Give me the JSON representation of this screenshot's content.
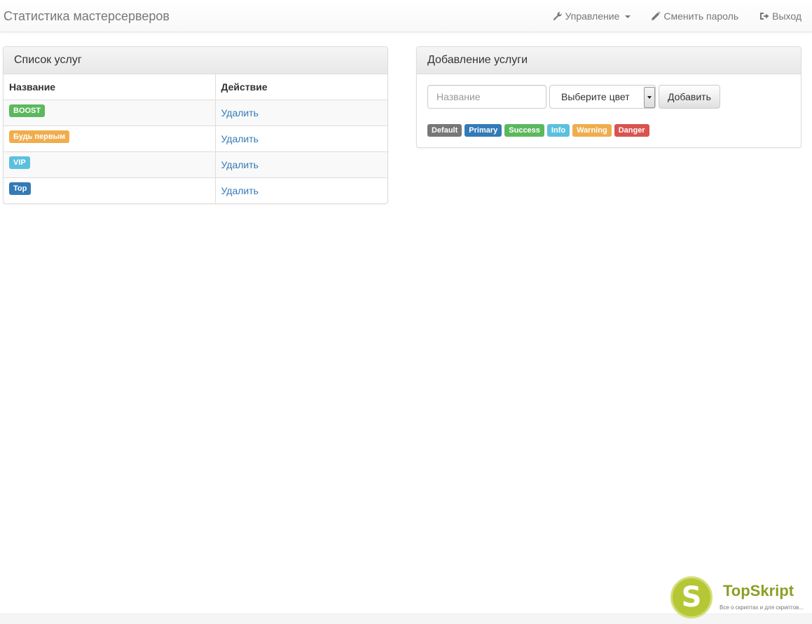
{
  "navbar": {
    "brand": "Статистика мастерсерверов",
    "manage_label": "Управление",
    "change_password_label": "Сменить пароль",
    "logout_label": "Выход"
  },
  "services_panel": {
    "title": "Список услуг",
    "columns": [
      "Название",
      "Действие"
    ],
    "rows": [
      {
        "name": "BOOST",
        "color": "#5cb85c",
        "action": "Удалить"
      },
      {
        "name": "Будь первым",
        "color": "#f0ad4e",
        "action": "Удалить"
      },
      {
        "name": "VIP",
        "color": "#5bc0de",
        "action": "Удалить"
      },
      {
        "name": "Top",
        "color": "#337ab7",
        "action": "Удалить"
      }
    ]
  },
  "add_panel": {
    "title": "Добавление услуги",
    "name_placeholder": "Название",
    "color_select_value": "Выберите цвет",
    "add_button": "Добавить",
    "color_labels": [
      {
        "text": "Default",
        "color": "#777777"
      },
      {
        "text": "Primary",
        "color": "#337ab7"
      },
      {
        "text": "Success",
        "color": "#5cb85c"
      },
      {
        "text": "Info",
        "color": "#5bc0de"
      },
      {
        "text": "Warning",
        "color": "#f0ad4e"
      },
      {
        "text": "Danger",
        "color": "#d9534f"
      }
    ]
  },
  "watermark": {
    "logo_letter": "S",
    "title": "TopSkript",
    "subtitle": "Все о скриптах и для скриптов..."
  }
}
